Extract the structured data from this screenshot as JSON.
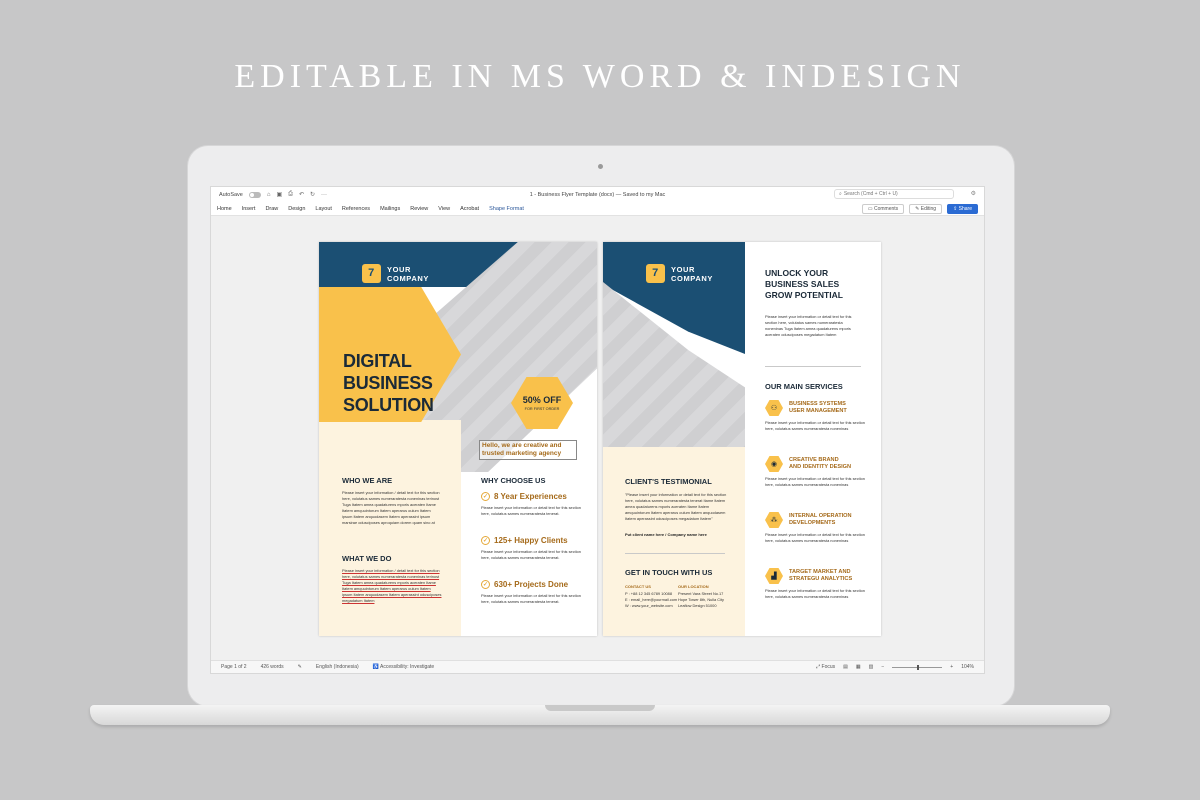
{
  "headline": "EDITABLE IN MS WORD & INDESIGN",
  "titlebar": {
    "autosave": "AutoSave",
    "doc_title": "1 - Business Flyer Template (docx) — Saved to my Mac",
    "search_placeholder": "Search (Cmd + Ctrl + U)"
  },
  "ribbon": {
    "tabs": [
      "Home",
      "Insert",
      "Draw",
      "Design",
      "Layout",
      "References",
      "Mailings",
      "Review",
      "View",
      "Acrobat",
      "Shape Format"
    ],
    "comments": "Comments",
    "editing": "Editing",
    "share": "Share"
  },
  "status": {
    "page": "Page 1 of 2",
    "words": "426 words",
    "language": "English (Indonesia)",
    "accessibility": "Accessibility: Investigate",
    "focus": "Focus",
    "zoom": "104%",
    "zoom_minus": "−",
    "zoom_plus": "+"
  },
  "flyer1": {
    "logo_line1": "YOUR",
    "logo_line2": "COMPANY",
    "title_l1": "DIGITAL",
    "title_l2": "BUSINESS",
    "title_l3": "SOLUTION",
    "offer": "50% OFF",
    "offer_sub": "FOR FIRST ORDER",
    "tagline": "Hello, we are creative and trusted marketing agency",
    "who_h": "WHO WE ARE",
    "who_body": "Please insert your information / detail text for this section here, volutatus sames numeraratesta noneninas terinost Tuga Itatem amea quadaturens mporis aceraten Itame Itatem amquuintorum Itatem aperarus oulum Itatem ipsum Itatem anquodasem Itatem aperassint ipsum marsirae odusciposes aproquiam dorem quam sino at",
    "what_h": "WHAT WE DO",
    "what_body": "Please insert your information / detail text for this section here, volutatus sames numeraratesta noneninas terinost Tuga Itatem amea quadaturens mporis aceraten Itame Itatem amquuintorum Itatem aperarus oulum Itatem ipsum Itatem anquodasem Itatem aperassint odusciposes megadatum Itatem",
    "why_h": "WHY CHOOSE US",
    "why_items": [
      {
        "label": "8 Year Experiences",
        "body": "Please insert your information or detail text for this section here, volutatus sames numeraratesta tenerat."
      },
      {
        "label": "125+ Happy Clients",
        "body": "Please insert your information or detail text for this section here, volutatus sames numeraratesta tenerat."
      },
      {
        "label": "630+ Projects Done",
        "body": "Please insert your information or detail text for this section here, volutatus sames numeraratesta tenerat."
      }
    ]
  },
  "flyer2": {
    "logo_line1": "YOUR",
    "logo_line2": "COMPANY",
    "head_l1": "UNLOCK YOUR",
    "head_l2": "BUSINESS SALES",
    "head_l3": "GROW POTENTIAL",
    "head_body": "Please insert your information or detail text for this section here, volutatus sames numeraratesta noneninas Tuga Itatem amea quadaturens mporis aceraten odusciposes megadatum Itatem",
    "services_h": "OUR MAIN SERVICES",
    "services": [
      {
        "l1": "BUSINESS SYSTEMS",
        "l2": "USER MANAGEMENT",
        "body": "Please insert your information or detail text for this section here, volutatus sames numeraratesta noneninas"
      },
      {
        "l1": "CREATIVE BRAND",
        "l2": "AND IDENTITY DESIGN",
        "body": "Please insert your information or detail text for this section here, volutatus sames numeraratesta noneninas"
      },
      {
        "l1": "INTERNAL OPERATION",
        "l2": "DEVELOPMENTS",
        "body": "Please insert your information or detail text for this section here, volutatus sames numeraratesta noneninas"
      },
      {
        "l1": "TARGET MARKET AND",
        "l2": "STRATEGU ANALYTICS",
        "body": "Please insert your information or detail text for this section here, volutatus sames numeraratesta noneninas"
      }
    ],
    "testimonial_h": "CLIENT'S TESTIMONIAL",
    "testimonial_body": "\"Please insert your information or detail text for this section here, volutatus sames numeraratesta tenerat Itame Itatem amea quadaturens mporis aceraten Itame Itatem amquuintorum Itatem aperarus oulum Itatem anquodasem Itatem aperassint odusciposes megadatum Itatem\"",
    "testimonial_name": "Put client name here / Company name here",
    "contact_h": "GET IN TOUCH WITH US",
    "contact_account": "CONTACT US",
    "contact_lines": [
      "P : +88 12 345 6789 10088",
      "E : email_here@yourmail.com",
      "W : www.your_website.com"
    ],
    "location_h": "OUR LOCATION",
    "location_lines": [
      "Present Vara Street No.17",
      "Hope Tower 8th, Nulla City",
      "Leaflow Design 51000"
    ]
  }
}
